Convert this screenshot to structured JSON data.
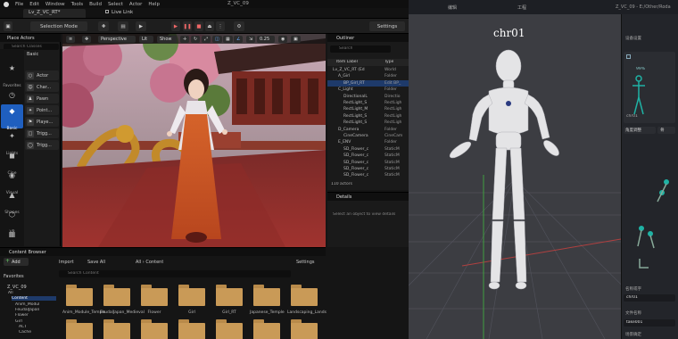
{
  "menu": {
    "items": [
      "File",
      "Edit",
      "Window",
      "Tools",
      "Build",
      "Select",
      "Actor",
      "Help"
    ],
    "window_title": "Z_VC_09"
  },
  "tabs": {
    "level": "Lv_Z_VC_RT*",
    "live_link": "Live Link"
  },
  "toolbar": {
    "selection_mode": "Selection Mode",
    "settings": "Settings"
  },
  "place_actors": {
    "title": "Place Actors",
    "search_placeholder": "Search Classes",
    "basic": "Basic",
    "categories": [
      "Favorites",
      "Recent",
      "Basic",
      "Lights",
      "Cine",
      "Visual",
      "Shapes",
      "VP",
      "Elec"
    ],
    "items": [
      "Actor",
      "Char...",
      "Pawn",
      "Point...",
      "Playe...",
      "Trigg...",
      "Trigg..."
    ]
  },
  "viewport": {
    "perspective": "Perspective",
    "lit": "Lit",
    "show": "Show",
    "scale": "0.25"
  },
  "outliner": {
    "title": "Outliner",
    "search_placeholder": "Search",
    "col_label": "Item Label",
    "col_type": "Type",
    "rows": [
      {
        "n": "Lv_Z_VC_RT (Ed",
        "t": "World"
      },
      {
        "n": "A_Girl",
        "t": "Folder"
      },
      {
        "n": "BP_Girl_RT",
        "t": "Edit BP_"
      },
      {
        "n": "C_Light",
        "t": "Folder"
      },
      {
        "n": "DirectionalL",
        "t": "Directio"
      },
      {
        "n": "RectLight_S",
        "t": "RectLigh"
      },
      {
        "n": "RectLight_M",
        "t": "RectLigh"
      },
      {
        "n": "RectLight_S",
        "t": "RectLigh"
      },
      {
        "n": "RectLight_S",
        "t": "RectLigh"
      },
      {
        "n": "D_Camera",
        "t": "Folder"
      },
      {
        "n": "CineCamera",
        "t": "CineCam"
      },
      {
        "n": "E_ENV",
        "t": "Folder"
      },
      {
        "n": "SD_Flower_c",
        "t": "StaticM"
      },
      {
        "n": "SD_Flower_c",
        "t": "StaticM"
      },
      {
        "n": "SD_Flower_c",
        "t": "StaticM"
      },
      {
        "n": "SD_Flower_c",
        "t": "StaticM"
      },
      {
        "n": "SD_Flower_c",
        "t": "StaticM"
      }
    ],
    "count": "110 actors"
  },
  "details": {
    "title": "Details",
    "hint": "Select an object to view details"
  },
  "content_browser": {
    "title": "Content Browser",
    "add": "Add",
    "import": "Import",
    "save_all": "Save All",
    "path_all": "All",
    "path_content": "Content",
    "settings": "Settings",
    "favorites": "Favorites",
    "project": "Z_VC_09",
    "search_placeholder": "Search Content",
    "folders": [
      "Anim_Module_Temple",
      "FeudalJapan_Medieval",
      "Flower",
      "Girl",
      "Girl_RT",
      "Japanese_Temple",
      "Landscaping_Lands"
    ],
    "tree": [
      "All",
      "Content",
      "Anim_Modul",
      "FeudalJapan",
      "Flower",
      "Girl",
      "ACT",
      "Cache"
    ]
  },
  "mocap": {
    "title": "Z_VC_09 - E:/Other/Roda",
    "tab_a": "编辑",
    "tab_b": "工程",
    "actor_label": "chr01",
    "panel": {
      "header": "设备设置",
      "pct": "99%",
      "chr_label": "chr01",
      "btn_a": "角度调整",
      "btn_b": "骨",
      "name_label": "名称或字",
      "name_value": "chr01",
      "file_label": "文件名称",
      "file_value": "take001",
      "foot_label": "场景确定"
    }
  }
}
